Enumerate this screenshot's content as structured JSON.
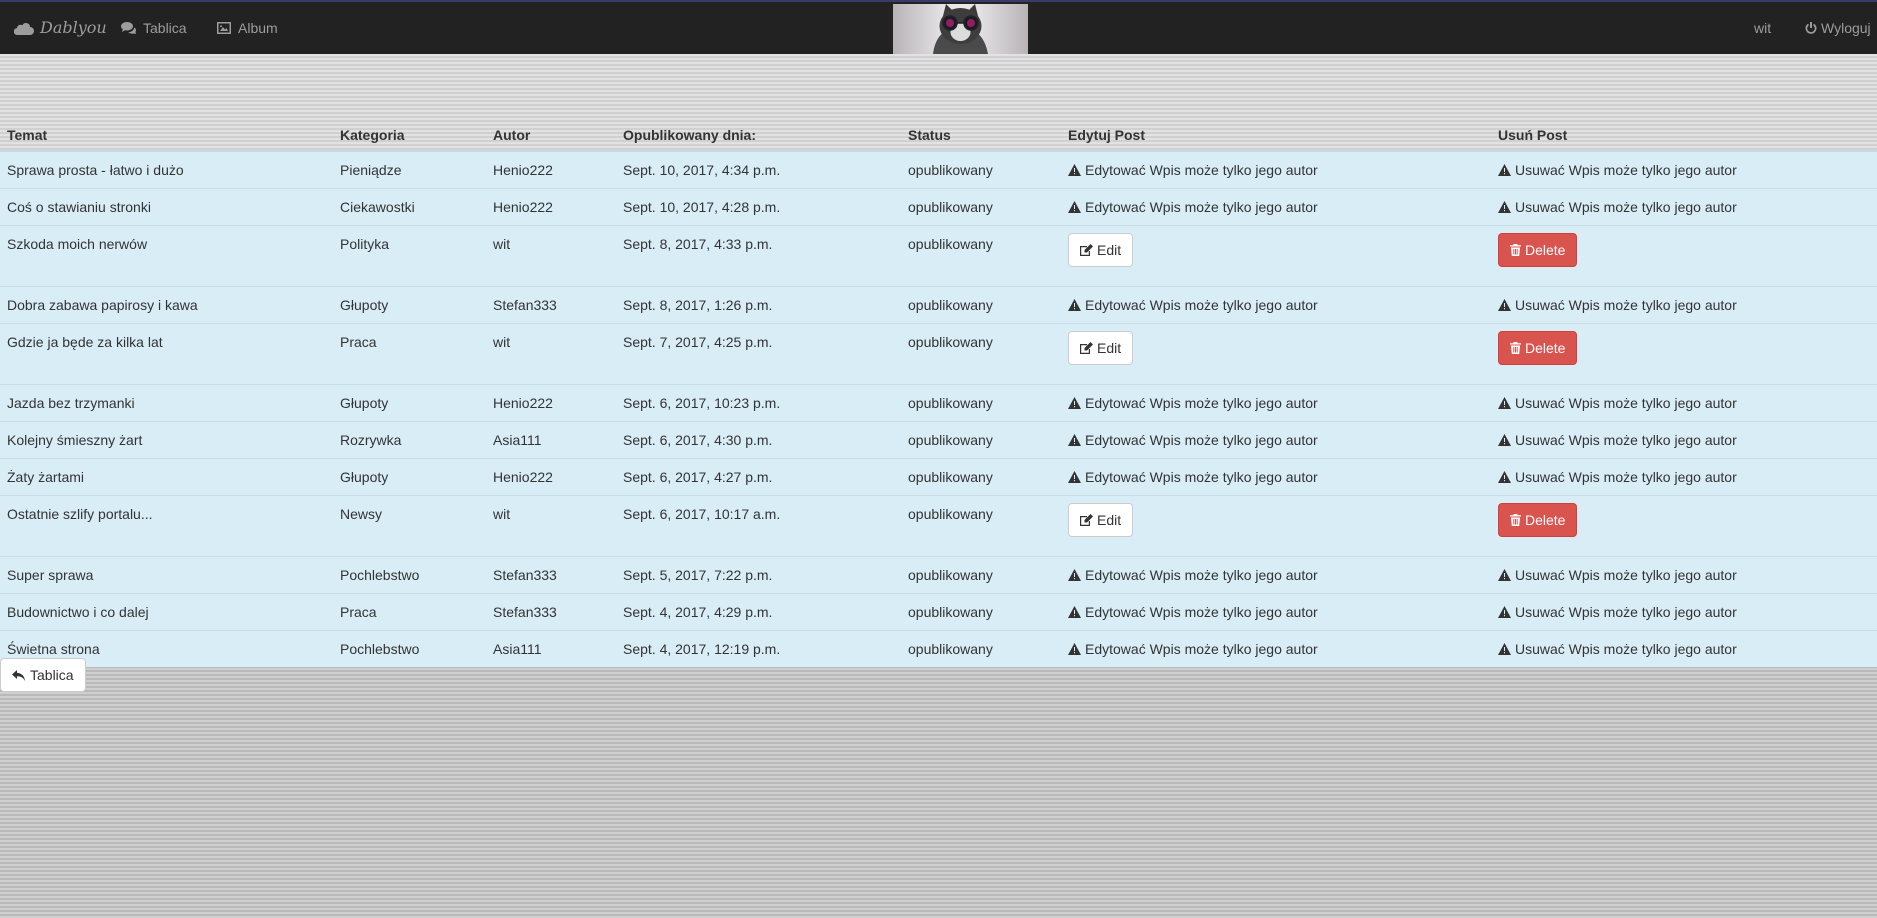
{
  "navbar": {
    "brand": "Dablyou",
    "links": [
      {
        "label": "Tablica",
        "icon": "comments-icon"
      },
      {
        "label": "Album",
        "icon": "picture-icon"
      }
    ],
    "user": "wit",
    "logout_label": "Wyloguj"
  },
  "table": {
    "headers": [
      "Temat",
      "Kategoria",
      "Autor",
      "Opublikowany dnia:",
      "Status",
      "Edytuj Post",
      "Usuń Post"
    ],
    "edit_warning": "Edytować Wpis może tylko jego autor",
    "delete_warning": "Usuwać Wpis może tylko jego autor",
    "edit_label": "Edit",
    "delete_label": "Delete",
    "rows": [
      {
        "temat": "Sprawa prosta - łatwo i dużo",
        "kategoria": "Pieniądze",
        "autor": "Henio222",
        "data": "Sept. 10, 2017, 4:34 p.m.",
        "status": "opublikowany",
        "own": false
      },
      {
        "temat": "Coś o stawianiu stronki",
        "kategoria": "Ciekawostki",
        "autor": "Henio222",
        "data": "Sept. 10, 2017, 4:28 p.m.",
        "status": "opublikowany",
        "own": false
      },
      {
        "temat": "Szkoda moich nerwów",
        "kategoria": "Polityka",
        "autor": "wit",
        "data": "Sept. 8, 2017, 4:33 p.m.",
        "status": "opublikowany",
        "own": true
      },
      {
        "temat": "Dobra zabawa papirosy i kawa",
        "kategoria": "Głupoty",
        "autor": "Stefan333",
        "data": "Sept. 8, 2017, 1:26 p.m.",
        "status": "opublikowany",
        "own": false
      },
      {
        "temat": "Gdzie ja będe za kilka lat",
        "kategoria": "Praca",
        "autor": "wit",
        "data": "Sept. 7, 2017, 4:25 p.m.",
        "status": "opublikowany",
        "own": true
      },
      {
        "temat": "Jazda bez trzymanki",
        "kategoria": "Głupoty",
        "autor": "Henio222",
        "data": "Sept. 6, 2017, 10:23 p.m.",
        "status": "opublikowany",
        "own": false
      },
      {
        "temat": "Kolejny śmieszny żart",
        "kategoria": "Rozrywka",
        "autor": "Asia111",
        "data": "Sept. 6, 2017, 4:30 p.m.",
        "status": "opublikowany",
        "own": false
      },
      {
        "temat": "Żaty żartami",
        "kategoria": "Głupoty",
        "autor": "Henio222",
        "data": "Sept. 6, 2017, 4:27 p.m.",
        "status": "opublikowany",
        "own": false
      },
      {
        "temat": "Ostatnie szlify portalu...",
        "kategoria": "Newsy",
        "autor": "wit",
        "data": "Sept. 6, 2017, 10:17 a.m.",
        "status": "opublikowany",
        "own": true
      },
      {
        "temat": "Super sprawa",
        "kategoria": "Pochlebstwo",
        "autor": "Stefan333",
        "data": "Sept. 5, 2017, 7:22 p.m.",
        "status": "opublikowany",
        "own": false
      },
      {
        "temat": "Budownictwo i co dalej",
        "kategoria": "Praca",
        "autor": "Stefan333",
        "data": "Sept. 4, 2017, 4:29 p.m.",
        "status": "opublikowany",
        "own": false
      },
      {
        "temat": "Świetna strona",
        "kategoria": "Pochlebstwo",
        "autor": "Asia111",
        "data": "Sept. 4, 2017, 12:19 p.m.",
        "status": "opublikowany",
        "own": false
      }
    ]
  },
  "back_button": {
    "label": "Tablica",
    "icon": "reply-icon"
  },
  "colors": {
    "navbar": "#222222",
    "row_bg": "#d9edf7",
    "delete": "#d9534f"
  }
}
